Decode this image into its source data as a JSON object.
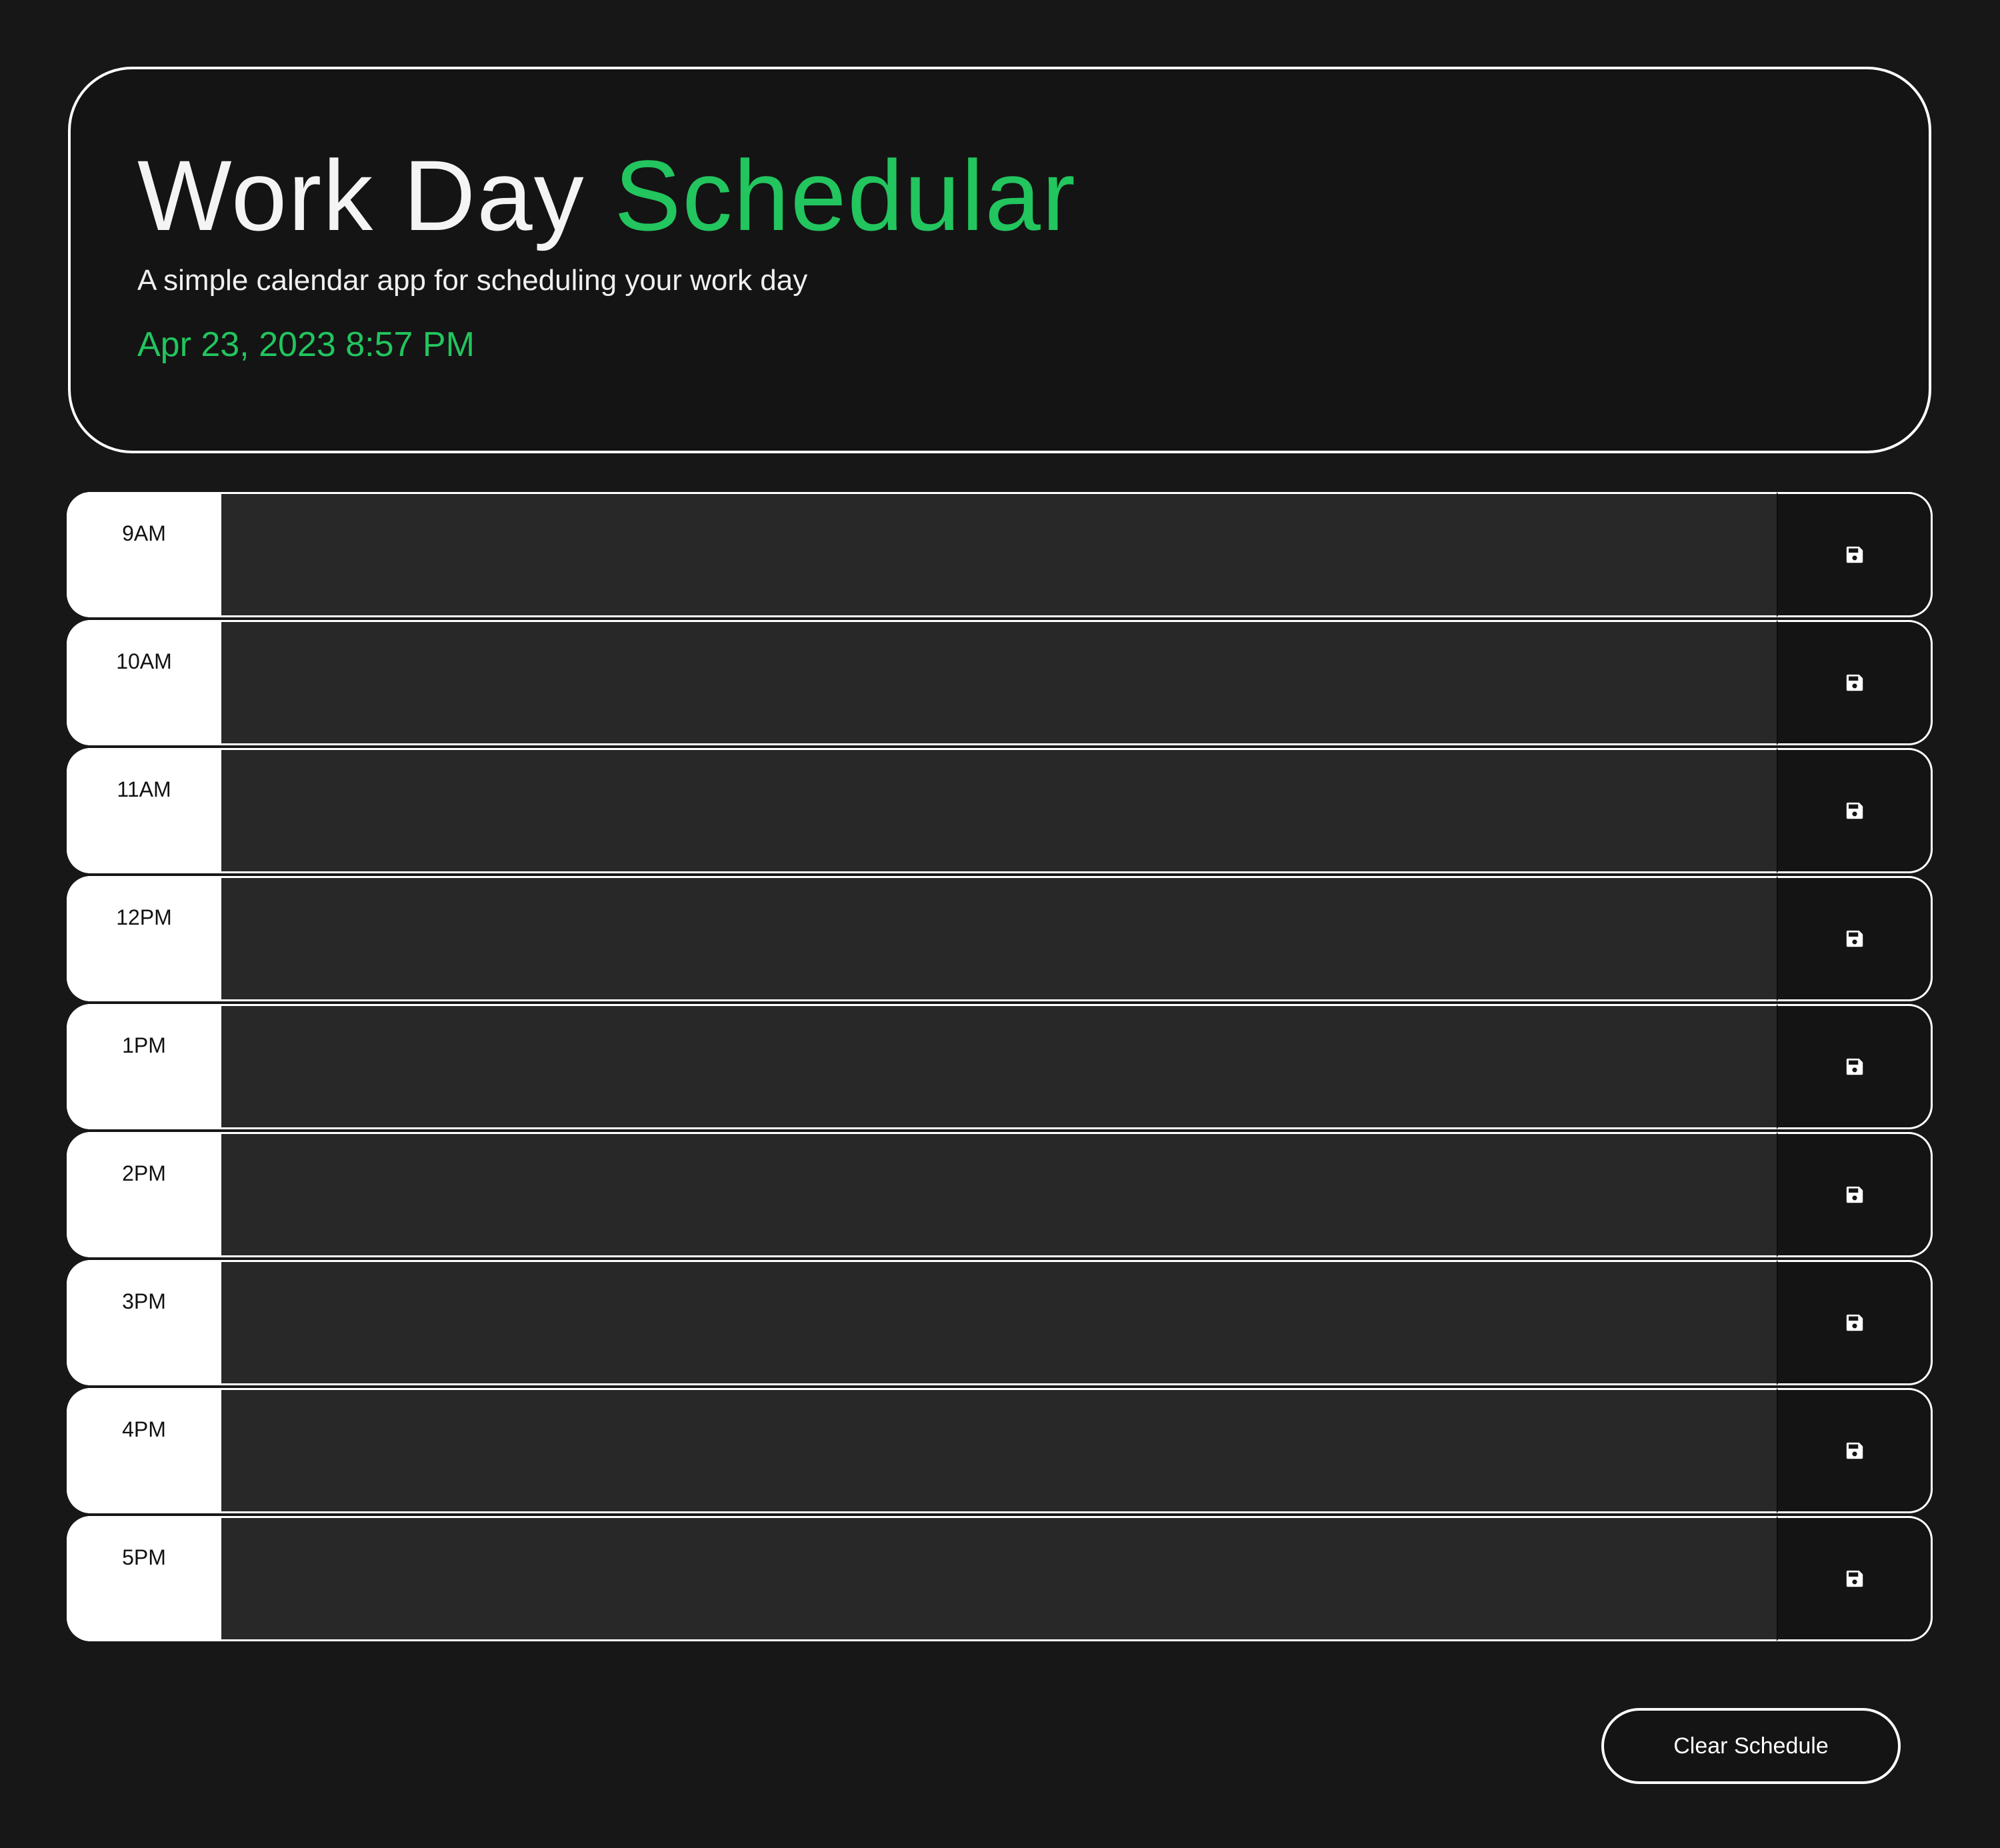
{
  "header": {
    "title_main": "Work Day",
    "title_accent": "Schedular",
    "subtitle": "A simple calendar app for scheduling your work day",
    "datetime": "Apr 23, 2023 8:57 PM"
  },
  "schedule": {
    "rows": [
      {
        "hour": "9AM",
        "text": ""
      },
      {
        "hour": "10AM",
        "text": ""
      },
      {
        "hour": "11AM",
        "text": ""
      },
      {
        "hour": "12PM",
        "text": ""
      },
      {
        "hour": "1PM",
        "text": ""
      },
      {
        "hour": "2PM",
        "text": ""
      },
      {
        "hour": "3PM",
        "text": ""
      },
      {
        "hour": "4PM",
        "text": ""
      },
      {
        "hour": "5PM",
        "text": ""
      }
    ],
    "save_icon": "floppy-disk-icon"
  },
  "footer": {
    "clear_label": "Clear Schedule"
  },
  "colors": {
    "background": "#171717",
    "accent": "#22c55e",
    "entry_bg": "#282828",
    "hour_bg": "#ffffff",
    "save_bg": "#141414"
  }
}
